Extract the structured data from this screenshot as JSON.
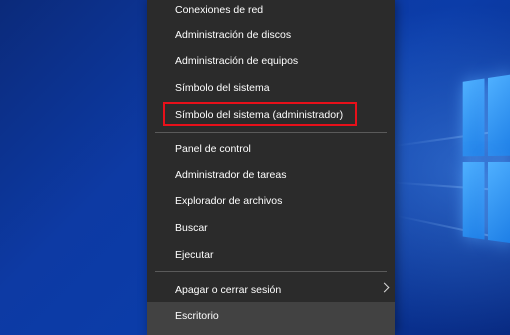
{
  "menu": {
    "items": [
      {
        "label": "Conexiones de red"
      },
      {
        "label": "Administración de discos"
      },
      {
        "label": "Administración de equipos"
      },
      {
        "label": "Símbolo del sistema"
      },
      {
        "label": "Símbolo del sistema (administrador)"
      },
      {
        "label": "Panel de control"
      },
      {
        "label": "Administrador de tareas"
      },
      {
        "label": "Explorador de archivos"
      },
      {
        "label": "Buscar"
      },
      {
        "label": "Ejecutar"
      },
      {
        "label": "Apagar o cerrar sesión"
      },
      {
        "label": "Escritorio"
      }
    ]
  },
  "colors": {
    "menu_background": "#2b2b2b",
    "selected_background": "#424242",
    "highlight_border": "#e8101a",
    "desktop_background": "#0b3ca8"
  }
}
